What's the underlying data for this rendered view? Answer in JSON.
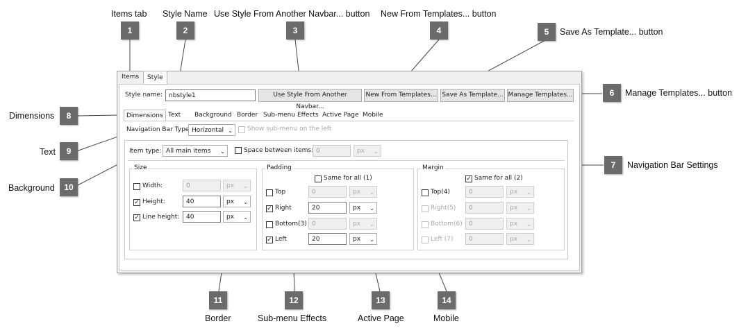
{
  "callouts": [
    {
      "num": "1",
      "label": "Items tab"
    },
    {
      "num": "2",
      "label": "Style Name"
    },
    {
      "num": "3",
      "label": "Use Style From Another Navbar... button"
    },
    {
      "num": "4",
      "label": "New From Templates... button"
    },
    {
      "num": "5",
      "label": "Save As Template... button"
    },
    {
      "num": "6",
      "label": "Manage Templates... button"
    },
    {
      "num": "7",
      "label": "Navigation Bar Settings"
    },
    {
      "num": "8",
      "label": "Dimensions"
    },
    {
      "num": "9",
      "label": "Text"
    },
    {
      "num": "10",
      "label": "Background"
    },
    {
      "num": "11",
      "label": "Border"
    },
    {
      "num": "12",
      "label": "Sub-menu Effects"
    },
    {
      "num": "13",
      "label": "Active Page"
    },
    {
      "num": "14",
      "label": "Mobile"
    }
  ],
  "dialog": {
    "tabs": [
      "Items",
      "Style"
    ],
    "style_name_label": "Style name:",
    "style_name_value": "nbstyle1",
    "buttons": {
      "use_style": "Use Style From Another Navbar...",
      "new_from_templates": "New From Templates...",
      "save_as_template": "Save As Template...",
      "manage_templates": "Manage Templates..."
    },
    "subtabs": [
      "Dimensions",
      "Text",
      "Background",
      "Border",
      "Sub-menu Effects",
      "Active Page",
      "Mobile"
    ],
    "nav_bar_type_label": "Navigation Bar Type:",
    "nav_bar_type_value": "Horizontal",
    "show_submenu_label": "Show sub-menu on the left",
    "item_type_label": "Item type:",
    "item_type_value": "All main items",
    "space_between_label": "Space between items:",
    "space_between_value": "0",
    "space_between_unit": "px",
    "size": {
      "title": "Size",
      "width_label": "Width:",
      "width_value": "0",
      "width_unit": "px",
      "height_label": "Height:",
      "height_value": "40",
      "height_unit": "px",
      "line_height_label": "Line height:",
      "line_height_value": "40",
      "line_height_unit": "px"
    },
    "padding": {
      "title": "Padding",
      "same_label": "Same for all (1)",
      "top_label": "Top",
      "top_value": "0",
      "top_unit": "px",
      "right_label": "Right",
      "right_value": "20",
      "right_unit": "px",
      "bottom_label": "Bottom(3)",
      "bottom_value": "0",
      "bottom_unit": "px",
      "left_label": "Left",
      "left_value": "20",
      "left_unit": "px"
    },
    "margin": {
      "title": "Margin",
      "same_label": "Same for all (2)",
      "top_label": "Top(4)",
      "top_value": "0",
      "top_unit": "px",
      "right_label": "Right(5)",
      "right_value": "0",
      "right_unit": "px",
      "bottom_label": "Bottom(6)",
      "bottom_value": "0",
      "bottom_unit": "px",
      "left_label": "Left (7)",
      "left_value": "0",
      "left_unit": "px"
    }
  }
}
